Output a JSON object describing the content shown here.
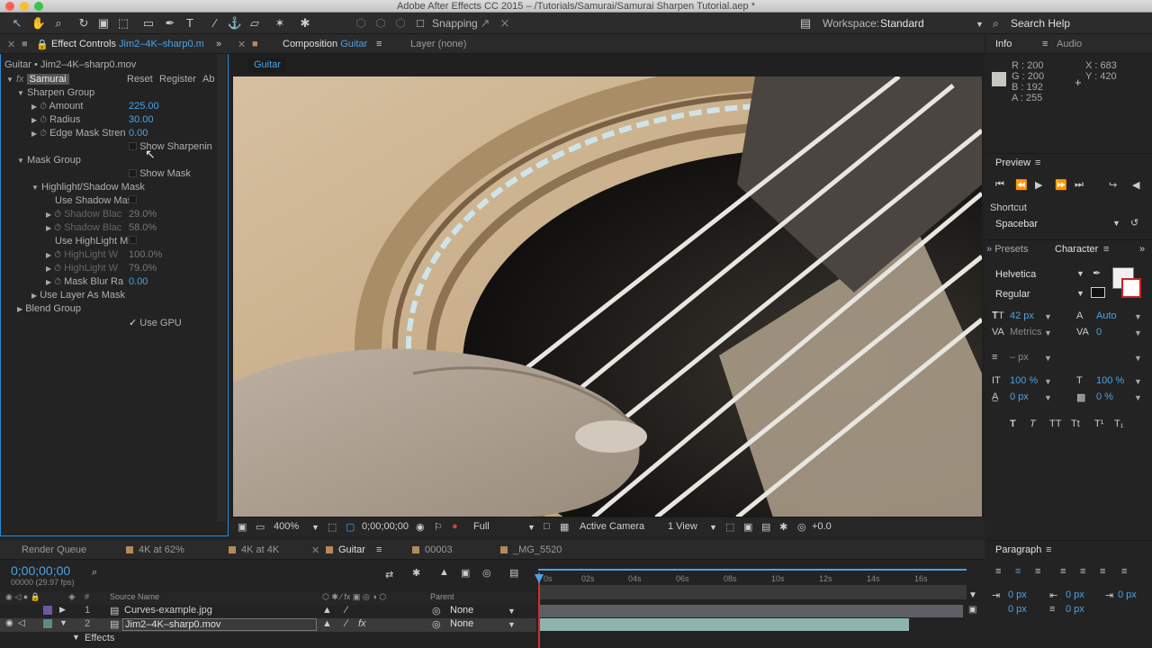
{
  "window": {
    "title": "Adobe After Effects CC 2015 – /Tutorials/Samurai/Samurai Sharpen Tutorial.aep *"
  },
  "toolbar": {
    "snapping_label": "Snapping",
    "workspace_label": "Workspace:",
    "workspace_value": "Standard",
    "search_help": "Search Help"
  },
  "effect_controls": {
    "tab_label": "Effect Controls",
    "tab_file": "Jim2–4K–sharp0.m",
    "layer_path": "Guitar • Jim2–4K–sharp0.mov",
    "effect_name": "Samurai",
    "reset": "Reset",
    "register": "Register",
    "about": "Ab",
    "sharpen_group": "Sharpen Group",
    "amount_label": "Amount",
    "amount_value": "225.00",
    "radius_label": "Radius",
    "radius_value": "30.00",
    "edge_mask_label": "Edge Mask Stren",
    "edge_mask_value": "0.00",
    "show_sharpening": "Show Sharpenin",
    "mask_group": "Mask Group",
    "show_mask": "Show Mask",
    "highlight_shadow_mask": "Highlight/Shadow Mask",
    "use_shadow_mask": "Use Shadow Mas",
    "shadow_blac1_label": "Shadow Blac",
    "shadow_blac1_value": "29.0%",
    "shadow_blac2_label": "Shadow Blac",
    "shadow_blac2_value": "58.0%",
    "use_highlight_mask": "Use HighLight M",
    "highlight_w1_label": "HighLight W",
    "highlight_w1_value": "100.0%",
    "highlight_w2_label": "HighLight W",
    "highlight_w2_value": "79.0%",
    "mask_blur_label": "Mask Blur Ra",
    "mask_blur_value": "0.00",
    "use_layer_as_mask": "Use Layer As Mask",
    "blend_group": "Blend Group",
    "use_gpu": "Use GPU"
  },
  "composition": {
    "tab_label": "Composition",
    "tab_name": "Guitar",
    "layer_tab": "Layer (none)",
    "comp_badge": "Guitar",
    "zoom": "400%",
    "timecode": "0;00;00;00",
    "resolution": "Full",
    "camera": "Active Camera",
    "views": "1 View",
    "exposure": "+0.0"
  },
  "info": {
    "tab_info": "Info",
    "tab_audio": "Audio",
    "r": "R : 200",
    "g": "G : 200",
    "b": "B : 192",
    "a": "A : 255",
    "x": "X : 683",
    "y": "Y : 420"
  },
  "preview": {
    "title": "Preview",
    "shortcut_label": "Shortcut",
    "shortcut_value": "Spacebar"
  },
  "character": {
    "tab_presets": "Presets",
    "tab_character": "Character",
    "font": "Helvetica",
    "style": "Regular",
    "size": "42 px",
    "leading": "Auto",
    "kerning": "Metrics",
    "tracking": "0",
    "stroke_width": "– px",
    "vscale": "100 %",
    "hscale": "100 %",
    "baseline": "0 px",
    "tsume": "0 %"
  },
  "paragraph": {
    "title": "Paragraph",
    "indent_left": "0 px",
    "indent_right": "0 px",
    "indent_first": "0 px",
    "space_before": "0 px",
    "space_after": "0 px"
  },
  "timeline": {
    "tabs": [
      "Render Queue",
      "4K at 62%",
      "4K at 4K",
      "Guitar",
      "00003",
      "_MG_5520"
    ],
    "timecode": "0;00;00;00",
    "fps": "00000 (29.97 fps)",
    "col_source": "Source Name",
    "col_parent": "Parent",
    "col_num": "#",
    "ruler": [
      "0s",
      "02s",
      "04s",
      "06s",
      "08s",
      "10s",
      "12s",
      "14s",
      "16s"
    ],
    "layers": [
      {
        "num": "1",
        "name": "Curves-example.jpg",
        "parent": "None"
      },
      {
        "num": "2",
        "name": "Jim2–4K–sharp0.mov",
        "parent": "None"
      }
    ],
    "effects_label": "Effects"
  }
}
